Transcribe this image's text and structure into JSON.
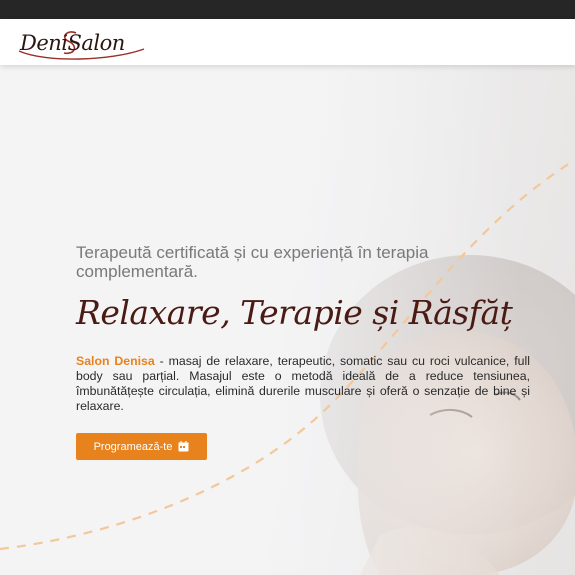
{
  "header": {
    "logo_text": "DeniSalon"
  },
  "hero": {
    "subtitle": "Terapeută certificată și cu experiență în terapia complementară.",
    "headline": "Relaxare, Terapie și Răsfăț",
    "brand_name": "Salon Denisa",
    "description": " - masaj de relaxare, terapeutic, somatic sau cu roci vulcanice, full body sau parțial. Masajul este o metodă ideală de a reduce tensiunea, îmbunătățește circulația, elimină durerile musculare și oferă o senzație de bine și relaxare.",
    "cta_label": "Programează-te",
    "cta_icon": "calendar-icon"
  },
  "colors": {
    "accent": "#e8821c",
    "headline": "#4a1a14",
    "topbar": "#262626",
    "dashed_curve": "#f2c89a"
  }
}
